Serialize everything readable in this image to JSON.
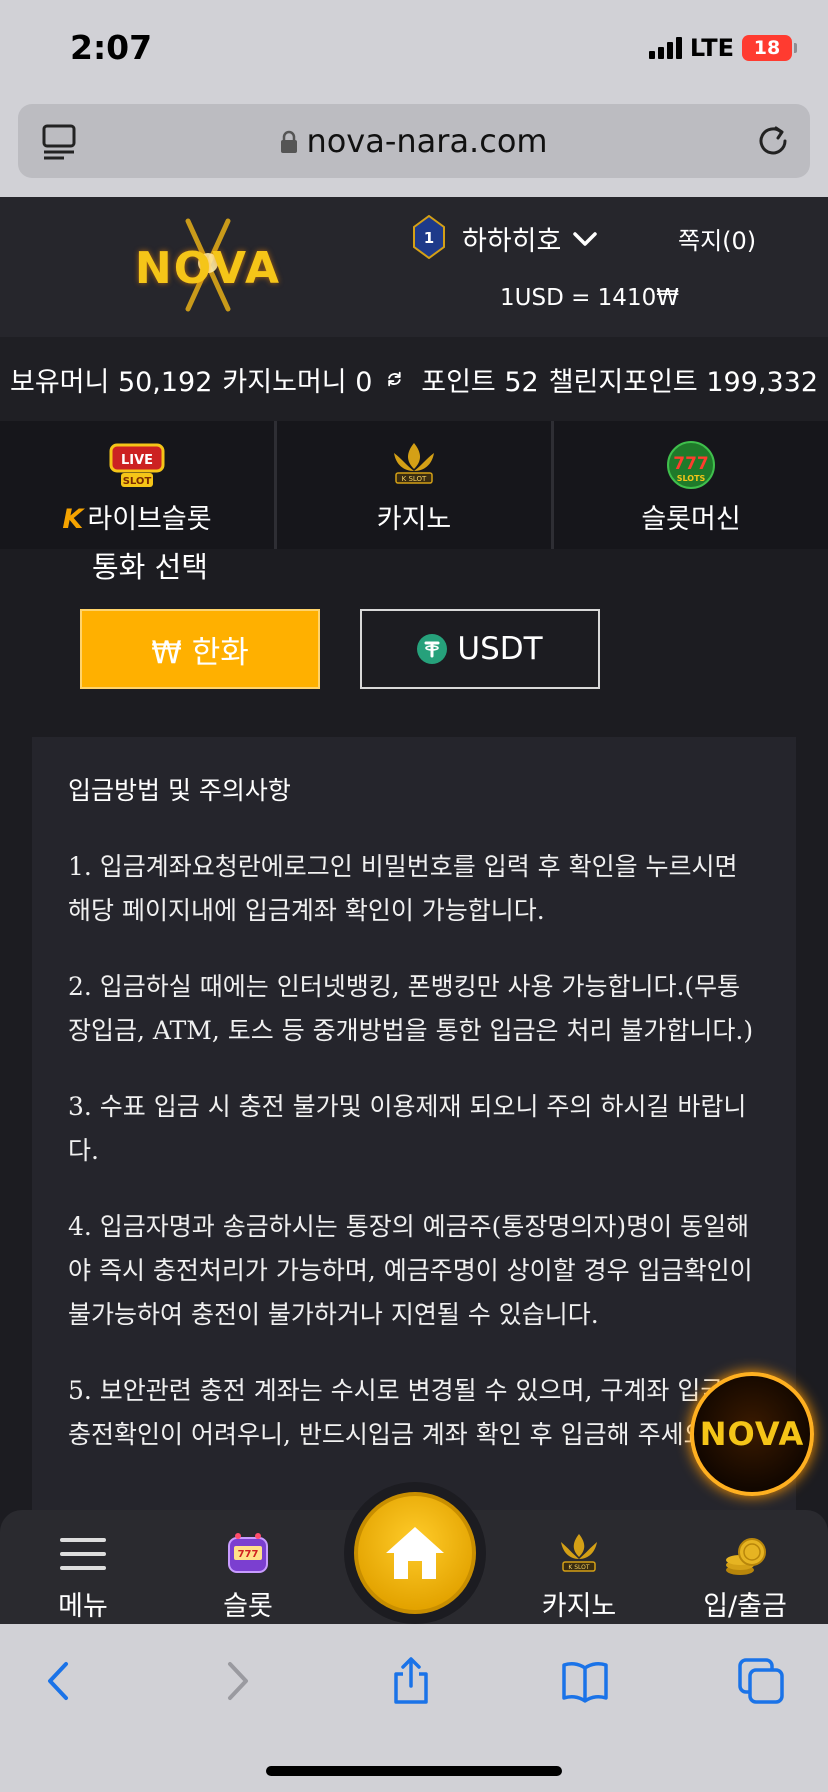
{
  "status_bar": {
    "time": "2:07",
    "network": "LTE",
    "battery": "18"
  },
  "browser": {
    "url": "nova-nara.com"
  },
  "header": {
    "logo_text": "NOVA",
    "level": "1",
    "username": "하하히호",
    "messages": "쪽지(0)",
    "exchange_rate": "1USD = 1410₩"
  },
  "balance": {
    "money": "보유머니 50,192",
    "casino_money": "카지노머니 0",
    "points": "포인트 52",
    "challenge_points": "챌린지포인트 199,332"
  },
  "categories": [
    {
      "label": "라이브슬롯",
      "prefix": "K",
      "icon": "live-slot-icon"
    },
    {
      "label": "카지노",
      "icon": "k-slot-casino-icon"
    },
    {
      "label": "슬롯머신",
      "icon": "777-slots-icon"
    }
  ],
  "currency": {
    "title": "통화 선택",
    "options": [
      {
        "label": "₩ 한화",
        "selected": true
      },
      {
        "label": "USDT",
        "selected": false
      }
    ]
  },
  "notice": {
    "title": "입금방법 및 주의사항",
    "items": [
      "1. 입금계좌요청란에로그인 비밀번호를 입력 후 확인을 누르시면 해당 페이지내에 입금계좌 확인이 가능합니다.",
      "2. 입금하실 때에는 인터넷뱅킹, 폰뱅킹만 사용 가능합니다.(무통장입금, ATM, 토스 등 중개방법을 통한 입금은 처리 불가합니다.)",
      "3. 수표 입금 시 충전 불가및 이용제재 되오니 주의 하시길 바랍니다.",
      "4. 입금자명과 송금하시는 통장의 예금주(통장명의자)명이 동일해야 즉시 충전처리가 가능하며, 예금주명이 상이할 경우 입금확인이 불가능하여 충전이 불가하거나 지연될 수 있습니다.",
      "5. 보안관련 충전 계좌는 수시로 변경될 수 있으며, 구계좌 입금 시 충전확인이 어려우니, 반드시입금 계좌 확인 후 입금해 주세요."
    ]
  },
  "floating": {
    "logo_text": "NOVA"
  },
  "bottom_nav": {
    "menu": "메뉴",
    "slot": "슬롯",
    "casino": "카지노",
    "deposit": "입/출금"
  },
  "colors": {
    "accent": "#ffb000",
    "background": "#1c1c21",
    "tether": "#26a17b"
  }
}
